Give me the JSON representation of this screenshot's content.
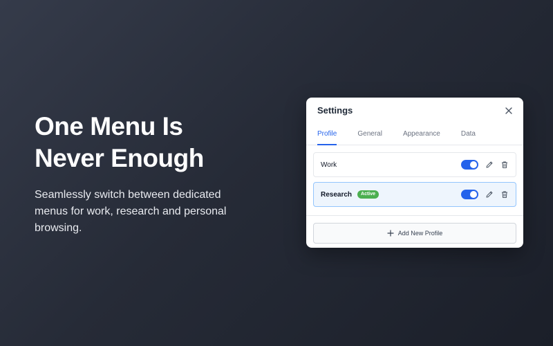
{
  "hero": {
    "title_line1": "One Menu Is",
    "title_line2": "Never Enough",
    "description": "Seamlessly switch between dedicated menus for work, research and personal browsing."
  },
  "settings": {
    "title": "Settings",
    "tabs": [
      {
        "label": "Profile",
        "active": true
      },
      {
        "label": "General",
        "active": false
      },
      {
        "label": "Appearance",
        "active": false
      },
      {
        "label": "Data",
        "active": false
      }
    ],
    "profiles": [
      {
        "name": "Work",
        "badge": "",
        "enabled": true,
        "selected": false
      },
      {
        "name": "Research",
        "badge": "Active",
        "enabled": true,
        "selected": true
      }
    ],
    "add_profile_label": "Add New Profile"
  },
  "icons": {
    "close": "close-icon",
    "edit": "pencil-icon",
    "delete": "trash-icon",
    "add": "plus-icon"
  },
  "colors": {
    "accent": "#2563eb",
    "badge": "#4caf50",
    "selected_row": "#eef5fd"
  }
}
